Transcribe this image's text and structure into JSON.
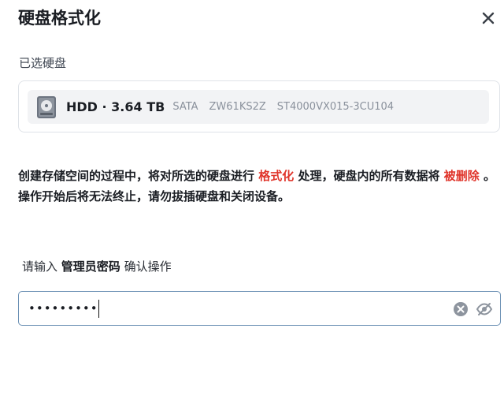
{
  "dialog": {
    "title": "硬盘格式化"
  },
  "selected_disk": {
    "label": "已选硬盘",
    "name": "HDD · 3.64 TB",
    "interface": "SATA",
    "serial": "ZW61KS2Z",
    "model": "ST4000VX015-3CU104"
  },
  "warning": {
    "part1": "创建存储空间的过程中，将对所选的硬盘进行 ",
    "highlight1": "格式化",
    "part2": " 处理，硬盘内的所有数据将 ",
    "highlight2": "被删除",
    "part3": " 。",
    "line2": "操作开始后将无法终止，请勿拔插硬盘和关闭设备。"
  },
  "password": {
    "prompt_prefix": "请输入 ",
    "prompt_strong": "管理员密码",
    "prompt_suffix": " 确认操作",
    "value": "•••••••••"
  },
  "colors": {
    "danger": "#e0352b",
    "input_border": "#6b90b4"
  },
  "icons": {
    "close": "close-icon",
    "disk": "hard-disk-icon",
    "clear": "clear-icon",
    "visibility": "eye-off-icon"
  }
}
